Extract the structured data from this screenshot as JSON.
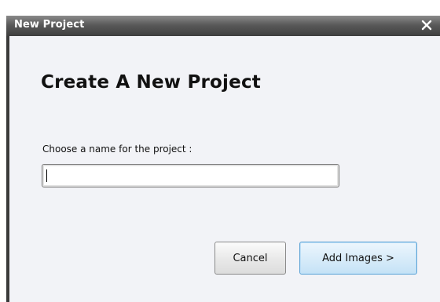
{
  "window": {
    "title": "New Project"
  },
  "dialog": {
    "heading": "Create A New Project",
    "name_label": "Choose a name for the project :",
    "name_value": "",
    "name_placeholder": ""
  },
  "buttons": {
    "cancel_label": "Cancel",
    "add_images_label": "Add Images >"
  },
  "icons": {
    "close": "close-icon"
  },
  "colors": {
    "titlebar": "#4a4a4a",
    "dialog_background": "#f2f3f7",
    "primary_button": "#d7ebf9",
    "primary_button_border": "#5fa4d6"
  }
}
